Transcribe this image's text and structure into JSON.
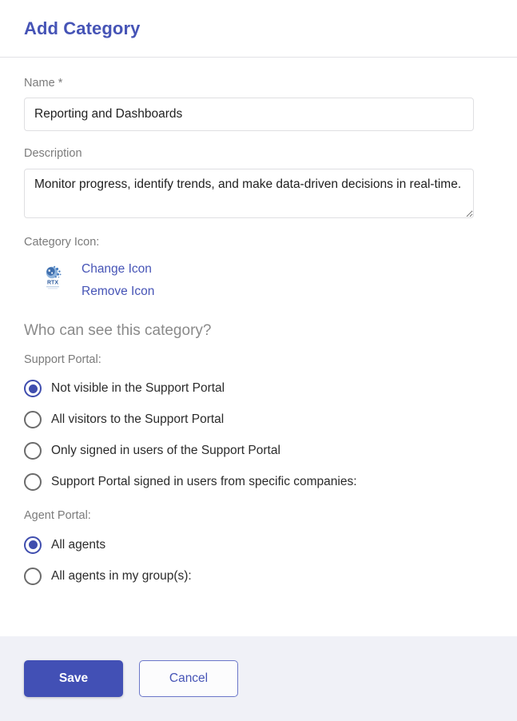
{
  "dialog": {
    "title": "Add Category"
  },
  "form": {
    "name": {
      "label": "Name *",
      "value": "Reporting and Dashboards",
      "placeholder": ""
    },
    "description": {
      "label": "Description",
      "value": "Monitor progress, identify trends, and make data-driven decisions in real-time.",
      "placeholder": ""
    },
    "category_icon": {
      "label": "Category Icon:",
      "icon_name": "rtx-logo-icon",
      "icon_caption": "RTX",
      "change_link": "Change Icon",
      "remove_link": "Remove Icon"
    }
  },
  "visibility": {
    "heading": "Who can see this category?",
    "support_portal": {
      "label": "Support Portal:",
      "options": [
        {
          "label": "Not visible in the Support Portal",
          "selected": true
        },
        {
          "label": "All visitors to the Support Portal",
          "selected": false
        },
        {
          "label": "Only signed in users of the Support Portal",
          "selected": false
        },
        {
          "label": "Support Portal signed in users from specific companies:",
          "selected": false
        }
      ]
    },
    "agent_portal": {
      "label": "Agent Portal:",
      "options": [
        {
          "label": "All agents",
          "selected": true
        },
        {
          "label": "All agents in my group(s):",
          "selected": false
        }
      ]
    }
  },
  "footer": {
    "save_label": "Save",
    "cancel_label": "Cancel"
  },
  "colors": {
    "accent": "#4654b6",
    "save_button": "#4250b5",
    "label_gray": "#7b7b7b",
    "footer_background": "#f0f1f7",
    "border": "#dfdfe2"
  }
}
